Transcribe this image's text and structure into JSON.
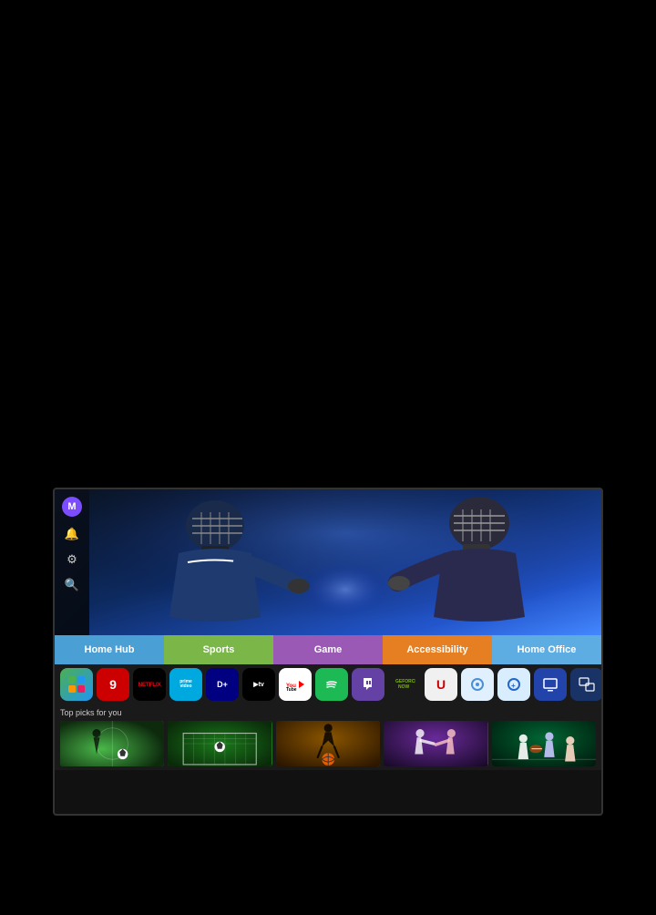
{
  "background": "#000000",
  "tv": {
    "sidebar": {
      "avatar_label": "M",
      "avatar_color": "#7c4dff",
      "icons": [
        "🔔",
        "⚙",
        "🔍"
      ]
    },
    "nav_tabs": [
      {
        "id": "home-hub",
        "label": "Home Hub",
        "color": "#4a9fd4",
        "active": true
      },
      {
        "id": "sports",
        "label": "Sports",
        "color": "#7ab648"
      },
      {
        "id": "game",
        "label": "Game",
        "color": "#9b59b6"
      },
      {
        "id": "accessibility",
        "label": "Accessibility",
        "color": "#e67e22"
      },
      {
        "id": "home-office",
        "label": "Home Office",
        "color": "#5dade2"
      }
    ],
    "apps": [
      {
        "id": "apps",
        "label": "APPS",
        "bg": "#4CAF50"
      },
      {
        "id": "9now",
        "label": "9",
        "bg": "#cc0000"
      },
      {
        "id": "netflix",
        "label": "NETFLIX",
        "bg": "#000000",
        "color": "#e50914"
      },
      {
        "id": "prime",
        "label": "prime video",
        "bg": "#00a8e0"
      },
      {
        "id": "disney",
        "label": "D+",
        "bg": "#000080"
      },
      {
        "id": "appletv",
        "label": "▶ tv",
        "bg": "#000000"
      },
      {
        "id": "youtube",
        "label": "▶ YouTube",
        "bg": "#ffffff",
        "color": "#ff0000"
      },
      {
        "id": "spotify",
        "label": "♫",
        "bg": "#1db954"
      },
      {
        "id": "twitch",
        "label": "⬛",
        "bg": "#6441a5"
      },
      {
        "id": "geforce",
        "label": "GFN",
        "bg": "#76b900"
      },
      {
        "id": "utv",
        "label": "U",
        "bg": "#f0f0f0",
        "color": "#000"
      },
      {
        "id": "circle1",
        "label": "◎",
        "bg": "#e8f4f8"
      },
      {
        "id": "circle2",
        "label": "⊕",
        "bg": "#d0e8ff"
      },
      {
        "id": "screen1",
        "label": "▣",
        "bg": "#2244aa"
      },
      {
        "id": "screen2",
        "label": "⊞",
        "bg": "#1a3366"
      }
    ],
    "top_picks": {
      "label": "Top picks for you",
      "cards": [
        {
          "id": "soccer1",
          "sport": "soccer",
          "emoji": "⚽"
        },
        {
          "id": "soccer2",
          "sport": "soccer-field",
          "emoji": "⚽"
        },
        {
          "id": "basketball",
          "sport": "basketball",
          "emoji": "🏀"
        },
        {
          "id": "boxing",
          "sport": "boxing",
          "emoji": "🥊"
        },
        {
          "id": "football",
          "sport": "football",
          "emoji": "🏈"
        }
      ]
    }
  }
}
